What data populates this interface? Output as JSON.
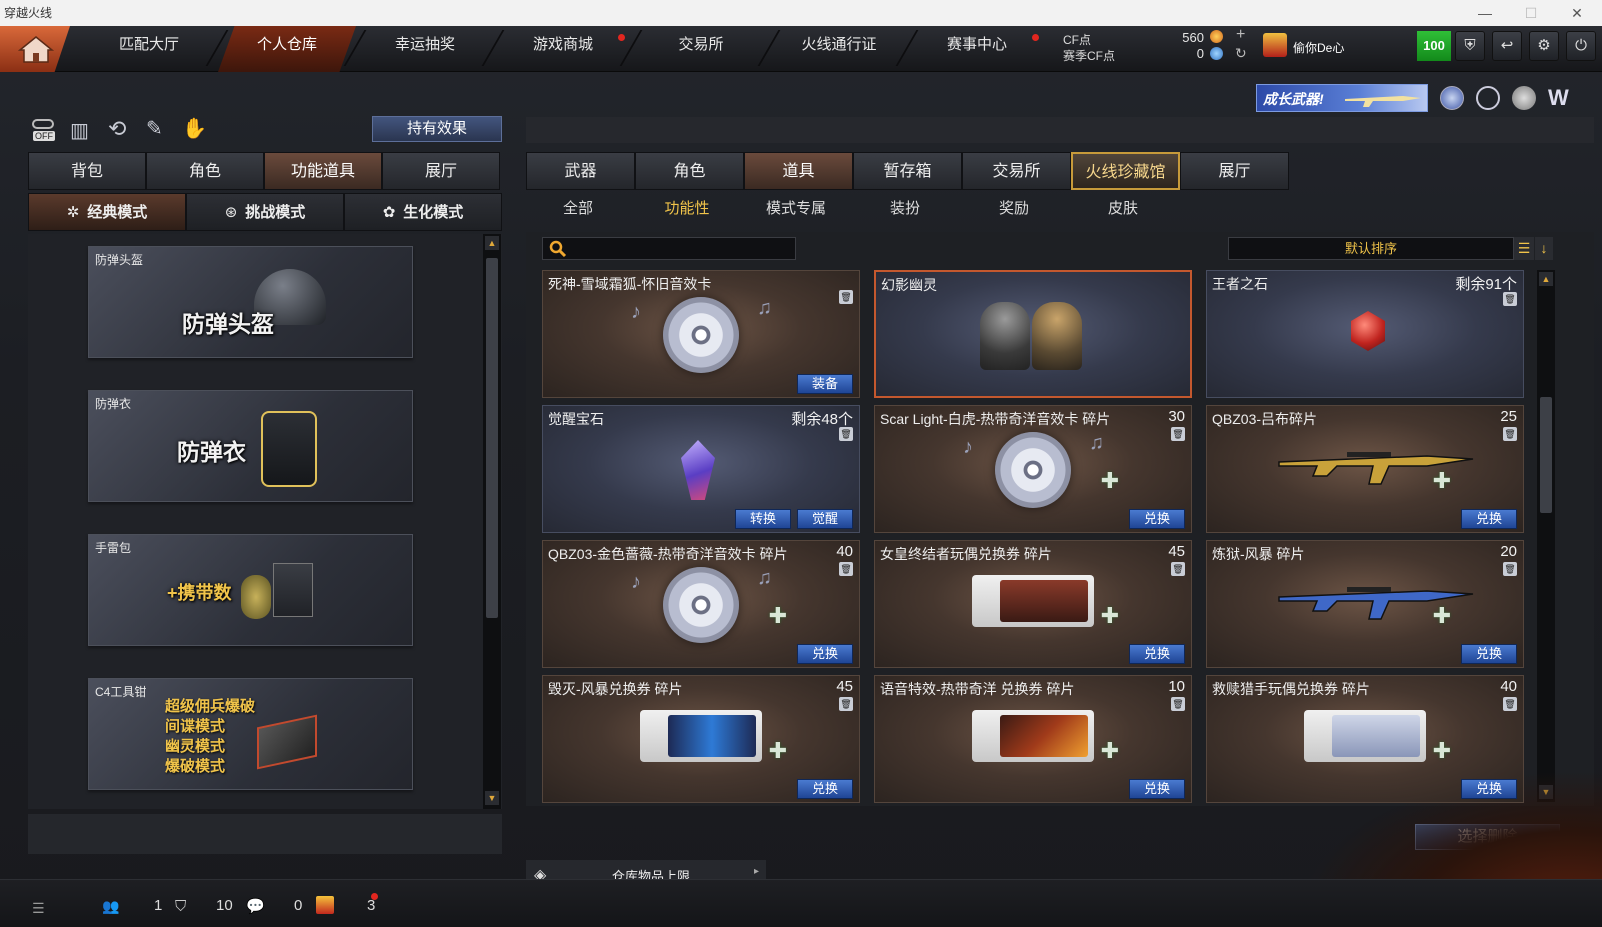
{
  "window": {
    "title": "穿越火线"
  },
  "nav": {
    "tabs": [
      {
        "label": "匹配大厅",
        "active": false,
        "dot": false
      },
      {
        "label": "个人仓库",
        "active": true,
        "dot": false
      },
      {
        "label": "幸运抽奖",
        "active": false,
        "dot": false
      },
      {
        "label": "游戏商城",
        "active": false,
        "dot": true
      },
      {
        "label": "交易所",
        "active": false,
        "dot": false
      },
      {
        "label": "火线通行证",
        "active": false,
        "dot": false
      },
      {
        "label": "赛事中心",
        "active": false,
        "dot": true
      }
    ],
    "cf_label": "CF点",
    "cf_value": "560",
    "season_cf_label": "赛季CF点",
    "season_cf_value": "0",
    "username": "偷你De心",
    "level": "100"
  },
  "promo": {
    "text": "成长武器!"
  },
  "left": {
    "effect_button": "持有效果",
    "off_label": "OFF",
    "tabs": [
      "背包",
      "角色",
      "功能道具",
      "展厅"
    ],
    "active_tab": 2,
    "modes": [
      "经典模式",
      "挑战模式",
      "生化模式"
    ],
    "items": [
      {
        "title": "防弹头盔",
        "big": "防弹头盔"
      },
      {
        "title": "防弹衣",
        "big": "防弹衣"
      },
      {
        "title": "手雷包",
        "big": "+携带数"
      },
      {
        "title": "C4工具钳",
        "lines": [
          "超级佣兵爆破",
          "间谍模式",
          "幽灵模式",
          "爆破模式"
        ]
      }
    ]
  },
  "right": {
    "tabs": [
      "武器",
      "角色",
      "道具",
      "暂存箱",
      "交易所",
      "火线珍藏馆",
      "展厅"
    ],
    "active_tab": 2,
    "highlight_tab": 5,
    "categories": [
      "全部",
      "功能性",
      "模式专属",
      "装扮",
      "奖励",
      "皮肤"
    ],
    "active_category": 1,
    "search_placeholder": "",
    "sort_label": "默认排序",
    "delete_button": "选择删除",
    "storage_limit": "仓库物品上限",
    "grid": [
      {
        "name": "死神-雪域霜狐-怀旧音效卡",
        "count": "",
        "buttons": [
          "装备"
        ],
        "type": "disc",
        "theme": "brown"
      },
      {
        "name": "幻影幽灵",
        "count": "",
        "buttons": [],
        "type": "chars",
        "theme": "blue",
        "selected": true
      },
      {
        "name": "王者之石",
        "count": "剩余91个",
        "buttons": [],
        "type": "redgem",
        "theme": "blue"
      },
      {
        "name": "觉醒宝石",
        "count": "剩余48个",
        "buttons": [
          "转换",
          "觉醒"
        ],
        "type": "purplegem",
        "theme": "blue"
      },
      {
        "name": "Scar Light-白虎-热带奇洋音效卡 碎片",
        "count": "30",
        "buttons": [
          "兑换"
        ],
        "type": "disc-puzzle",
        "theme": "brown"
      },
      {
        "name": "QBZ03-吕布碎片",
        "count": "25",
        "buttons": [
          "兑换"
        ],
        "type": "gun-gold",
        "theme": "brown"
      },
      {
        "name": "QBZ03-金色蔷薇-热带奇洋音效卡 碎片",
        "count": "40",
        "buttons": [
          "兑换"
        ],
        "type": "disc-puzzle",
        "theme": "brown"
      },
      {
        "name": "女皇终结者玩偶兑换券 碎片",
        "count": "45",
        "buttons": [
          "兑换"
        ],
        "type": "ticket-red",
        "theme": "brown"
      },
      {
        "name": "炼狱-风暴 碎片",
        "count": "20",
        "buttons": [
          "兑换"
        ],
        "type": "gun-blue",
        "theme": "brown"
      },
      {
        "name": "毁灭-风暴兑换券 碎片",
        "count": "45",
        "buttons": [
          "兑换"
        ],
        "type": "ticket-blue",
        "theme": "brown"
      },
      {
        "name": "语音特效-热带奇洋 兑换券 碎片",
        "count": "10",
        "buttons": [
          "兑换"
        ],
        "type": "ticket-orange",
        "theme": "brown"
      },
      {
        "name": "救赎猎手玩偶兑换券 碎片",
        "count": "40",
        "buttons": [
          "兑换"
        ],
        "type": "ticket-white",
        "theme": "brown"
      }
    ]
  },
  "bottom": {
    "v1": "1",
    "v2": "10",
    "v3": "0",
    "v4": "3"
  },
  "colors": {
    "accent": "#c4582e",
    "button_blue": "#2f5bb3",
    "gold": "#f1c44a"
  }
}
